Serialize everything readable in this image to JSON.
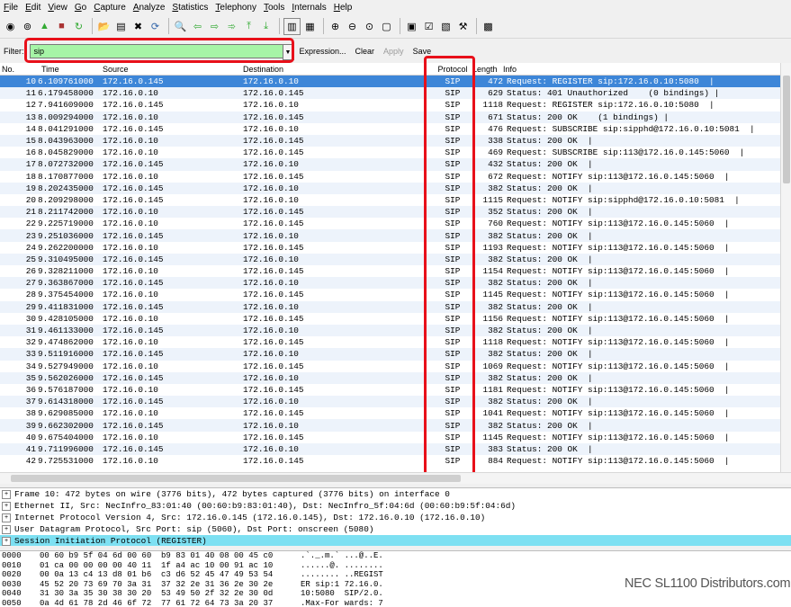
{
  "menu": [
    "File",
    "Edit",
    "View",
    "Go",
    "Capture",
    "Analyze",
    "Statistics",
    "Telephony",
    "Tools",
    "Internals",
    "Help"
  ],
  "filter": {
    "label": "Filter:",
    "value": "sip",
    "expression_label": "Expression...",
    "clear_label": "Clear",
    "apply_label": "Apply",
    "save_label": "Save"
  },
  "columns": {
    "no": "No.",
    "time": "Time",
    "source": "Source",
    "destination": "Destination",
    "protocol": "Protocol",
    "length": "Length",
    "info": "Info"
  },
  "packets": [
    {
      "no": "10",
      "time": "6.109761000",
      "src": "172.16.0.145",
      "dst": "172.16.0.10",
      "proto": "SIP",
      "len": "472",
      "info": "Request: REGISTER sip:172.16.0.10:5080  |"
    },
    {
      "no": "11",
      "time": "6.179458000",
      "src": "172.16.0.10",
      "dst": "172.16.0.145",
      "proto": "SIP",
      "len": "629",
      "info": "Status: 401 Unauthorized    (0 bindings) |"
    },
    {
      "no": "12",
      "time": "7.941609000",
      "src": "172.16.0.145",
      "dst": "172.16.0.10",
      "proto": "SIP",
      "len": "1118",
      "info": "Request: REGISTER sip:172.16.0.10:5080  |"
    },
    {
      "no": "13",
      "time": "8.009294000",
      "src": "172.16.0.10",
      "dst": "172.16.0.145",
      "proto": "SIP",
      "len": "671",
      "info": "Status: 200 OK    (1 bindings) |"
    },
    {
      "no": "14",
      "time": "8.041291000",
      "src": "172.16.0.145",
      "dst": "172.16.0.10",
      "proto": "SIP",
      "len": "476",
      "info": "Request: SUBSCRIBE sip:sipphd@172.16.0.10:5081  |"
    },
    {
      "no": "15",
      "time": "8.043963000",
      "src": "172.16.0.10",
      "dst": "172.16.0.145",
      "proto": "SIP",
      "len": "338",
      "info": "Status: 200 OK  |"
    },
    {
      "no": "16",
      "time": "8.045829000",
      "src": "172.16.0.10",
      "dst": "172.16.0.145",
      "proto": "SIP",
      "len": "469",
      "info": "Request: SUBSCRIBE sip:113@172.16.0.145:5060  |"
    },
    {
      "no": "17",
      "time": "8.072732000",
      "src": "172.16.0.145",
      "dst": "172.16.0.10",
      "proto": "SIP",
      "len": "432",
      "info": "Status: 200 OK  |"
    },
    {
      "no": "18",
      "time": "8.170877000",
      "src": "172.16.0.10",
      "dst": "172.16.0.145",
      "proto": "SIP",
      "len": "672",
      "info": "Request: NOTIFY sip:113@172.16.0.145:5060  |"
    },
    {
      "no": "19",
      "time": "8.202435000",
      "src": "172.16.0.145",
      "dst": "172.16.0.10",
      "proto": "SIP",
      "len": "382",
      "info": "Status: 200 OK  |"
    },
    {
      "no": "20",
      "time": "8.209298000",
      "src": "172.16.0.145",
      "dst": "172.16.0.10",
      "proto": "SIP",
      "len": "1115",
      "info": "Request: NOTIFY sip:sipphd@172.16.0.10:5081  |"
    },
    {
      "no": "21",
      "time": "8.211742000",
      "src": "172.16.0.10",
      "dst": "172.16.0.145",
      "proto": "SIP",
      "len": "352",
      "info": "Status: 200 OK  |"
    },
    {
      "no": "22",
      "time": "9.225719000",
      "src": "172.16.0.10",
      "dst": "172.16.0.145",
      "proto": "SIP",
      "len": "760",
      "info": "Request: NOTIFY sip:113@172.16.0.145:5060  |"
    },
    {
      "no": "23",
      "time": "9.251036000",
      "src": "172.16.0.145",
      "dst": "172.16.0.10",
      "proto": "SIP",
      "len": "382",
      "info": "Status: 200 OK  |"
    },
    {
      "no": "24",
      "time": "9.262200000",
      "src": "172.16.0.10",
      "dst": "172.16.0.145",
      "proto": "SIP",
      "len": "1193",
      "info": "Request: NOTIFY sip:113@172.16.0.145:5060  |"
    },
    {
      "no": "25",
      "time": "9.310495000",
      "src": "172.16.0.145",
      "dst": "172.16.0.10",
      "proto": "SIP",
      "len": "382",
      "info": "Status: 200 OK  |"
    },
    {
      "no": "26",
      "time": "9.328211000",
      "src": "172.16.0.10",
      "dst": "172.16.0.145",
      "proto": "SIP",
      "len": "1154",
      "info": "Request: NOTIFY sip:113@172.16.0.145:5060  |"
    },
    {
      "no": "27",
      "time": "9.363867000",
      "src": "172.16.0.145",
      "dst": "172.16.0.10",
      "proto": "SIP",
      "len": "382",
      "info": "Status: 200 OK  |"
    },
    {
      "no": "28",
      "time": "9.375454000",
      "src": "172.16.0.10",
      "dst": "172.16.0.145",
      "proto": "SIP",
      "len": "1145",
      "info": "Request: NOTIFY sip:113@172.16.0.145:5060  |"
    },
    {
      "no": "29",
      "time": "9.411831000",
      "src": "172.16.0.145",
      "dst": "172.16.0.10",
      "proto": "SIP",
      "len": "382",
      "info": "Status: 200 OK  |"
    },
    {
      "no": "30",
      "time": "9.428105000",
      "src": "172.16.0.10",
      "dst": "172.16.0.145",
      "proto": "SIP",
      "len": "1156",
      "info": "Request: NOTIFY sip:113@172.16.0.145:5060  |"
    },
    {
      "no": "31",
      "time": "9.461133000",
      "src": "172.16.0.145",
      "dst": "172.16.0.10",
      "proto": "SIP",
      "len": "382",
      "info": "Status: 200 OK  |"
    },
    {
      "no": "32",
      "time": "9.474862000",
      "src": "172.16.0.10",
      "dst": "172.16.0.145",
      "proto": "SIP",
      "len": "1118",
      "info": "Request: NOTIFY sip:113@172.16.0.145:5060  |"
    },
    {
      "no": "33",
      "time": "9.511916000",
      "src": "172.16.0.145",
      "dst": "172.16.0.10",
      "proto": "SIP",
      "len": "382",
      "info": "Status: 200 OK  |"
    },
    {
      "no": "34",
      "time": "9.527949000",
      "src": "172.16.0.10",
      "dst": "172.16.0.145",
      "proto": "SIP",
      "len": "1069",
      "info": "Request: NOTIFY sip:113@172.16.0.145:5060  |"
    },
    {
      "no": "35",
      "time": "9.562026000",
      "src": "172.16.0.145",
      "dst": "172.16.0.10",
      "proto": "SIP",
      "len": "382",
      "info": "Status: 200 OK  |"
    },
    {
      "no": "36",
      "time": "9.576187000",
      "src": "172.16.0.10",
      "dst": "172.16.0.145",
      "proto": "SIP",
      "len": "1181",
      "info": "Request: NOTIFY sip:113@172.16.0.145:5060  |"
    },
    {
      "no": "37",
      "time": "9.614318000",
      "src": "172.16.0.145",
      "dst": "172.16.0.10",
      "proto": "SIP",
      "len": "382",
      "info": "Status: 200 OK  |"
    },
    {
      "no": "38",
      "time": "9.629085000",
      "src": "172.16.0.10",
      "dst": "172.16.0.145",
      "proto": "SIP",
      "len": "1041",
      "info": "Request: NOTIFY sip:113@172.16.0.145:5060  |"
    },
    {
      "no": "39",
      "time": "9.662302000",
      "src": "172.16.0.145",
      "dst": "172.16.0.10",
      "proto": "SIP",
      "len": "382",
      "info": "Status: 200 OK  |"
    },
    {
      "no": "40",
      "time": "9.675404000",
      "src": "172.16.0.10",
      "dst": "172.16.0.145",
      "proto": "SIP",
      "len": "1145",
      "info": "Request: NOTIFY sip:113@172.16.0.145:5060  |"
    },
    {
      "no": "41",
      "time": "9.711996000",
      "src": "172.16.0.145",
      "dst": "172.16.0.10",
      "proto": "SIP",
      "len": "383",
      "info": "Status: 200 OK  |"
    },
    {
      "no": "42",
      "time": "9.725531000",
      "src": "172.16.0.10",
      "dst": "172.16.0.145",
      "proto": "SIP",
      "len": "884",
      "info": "Request: NOTIFY sip:113@172.16.0.145:5060  |"
    }
  ],
  "details": [
    "Frame 10: 472 bytes on wire (3776 bits), 472 bytes captured (3776 bits) on interface 0",
    "Ethernet II, Src: NecInfro_83:01:40 (00:60:b9:83:01:40), Dst: NecInfro_5f:04:6d (00:60:b9:5f:04:6d)",
    "Internet Protocol Version 4, Src: 172.16.0.145 (172.16.0.145), Dst: 172.16.0.10 (172.16.0.10)",
    "User Datagram Protocol, Src Port: sip (5060), Dst Port: onscreen (5080)",
    "Session Initiation Protocol (REGISTER)"
  ],
  "hex": [
    {
      "off": "0000",
      "hex": "00 60 b9 5f 04 6d 00 60  b9 83 01 40 08 00 45 c0",
      "asc": ".`._.m.` ...@..E."
    },
    {
      "off": "0010",
      "hex": "01 ca 00 00 00 00 40 11  1f a4 ac 10 00 91 ac 10",
      "asc": "......@. ........"
    },
    {
      "off": "0020",
      "hex": "00 0a 13 c4 13 d8 01 b6  c3 d6 52 45 47 49 53 54",
      "asc": "........ ..REGIST"
    },
    {
      "off": "0030",
      "hex": "45 52 20 73 69 70 3a 31  37 32 2e 31 36 2e 30 2e",
      "asc": "ER sip:1 72.16.0."
    },
    {
      "off": "0040",
      "hex": "31 30 3a 35 30 38 30 20  53 49 50 2f 32 2e 30 0d",
      "asc": "10:5080  SIP/2.0."
    },
    {
      "off": "0050",
      "hex": "0a 4d 61 78 2d 46 6f 72  77 61 72 64 73 3a 20 37",
      "asc": ".Max-For wards: 7"
    }
  ],
  "watermark": "NEC SL1100 Distributors.com",
  "colors": {
    "selected_row": "#3d86d8",
    "filter_bg": "#a6f4a6",
    "highlight": "#e8101a",
    "detail_highlight": "#7de0f2"
  }
}
